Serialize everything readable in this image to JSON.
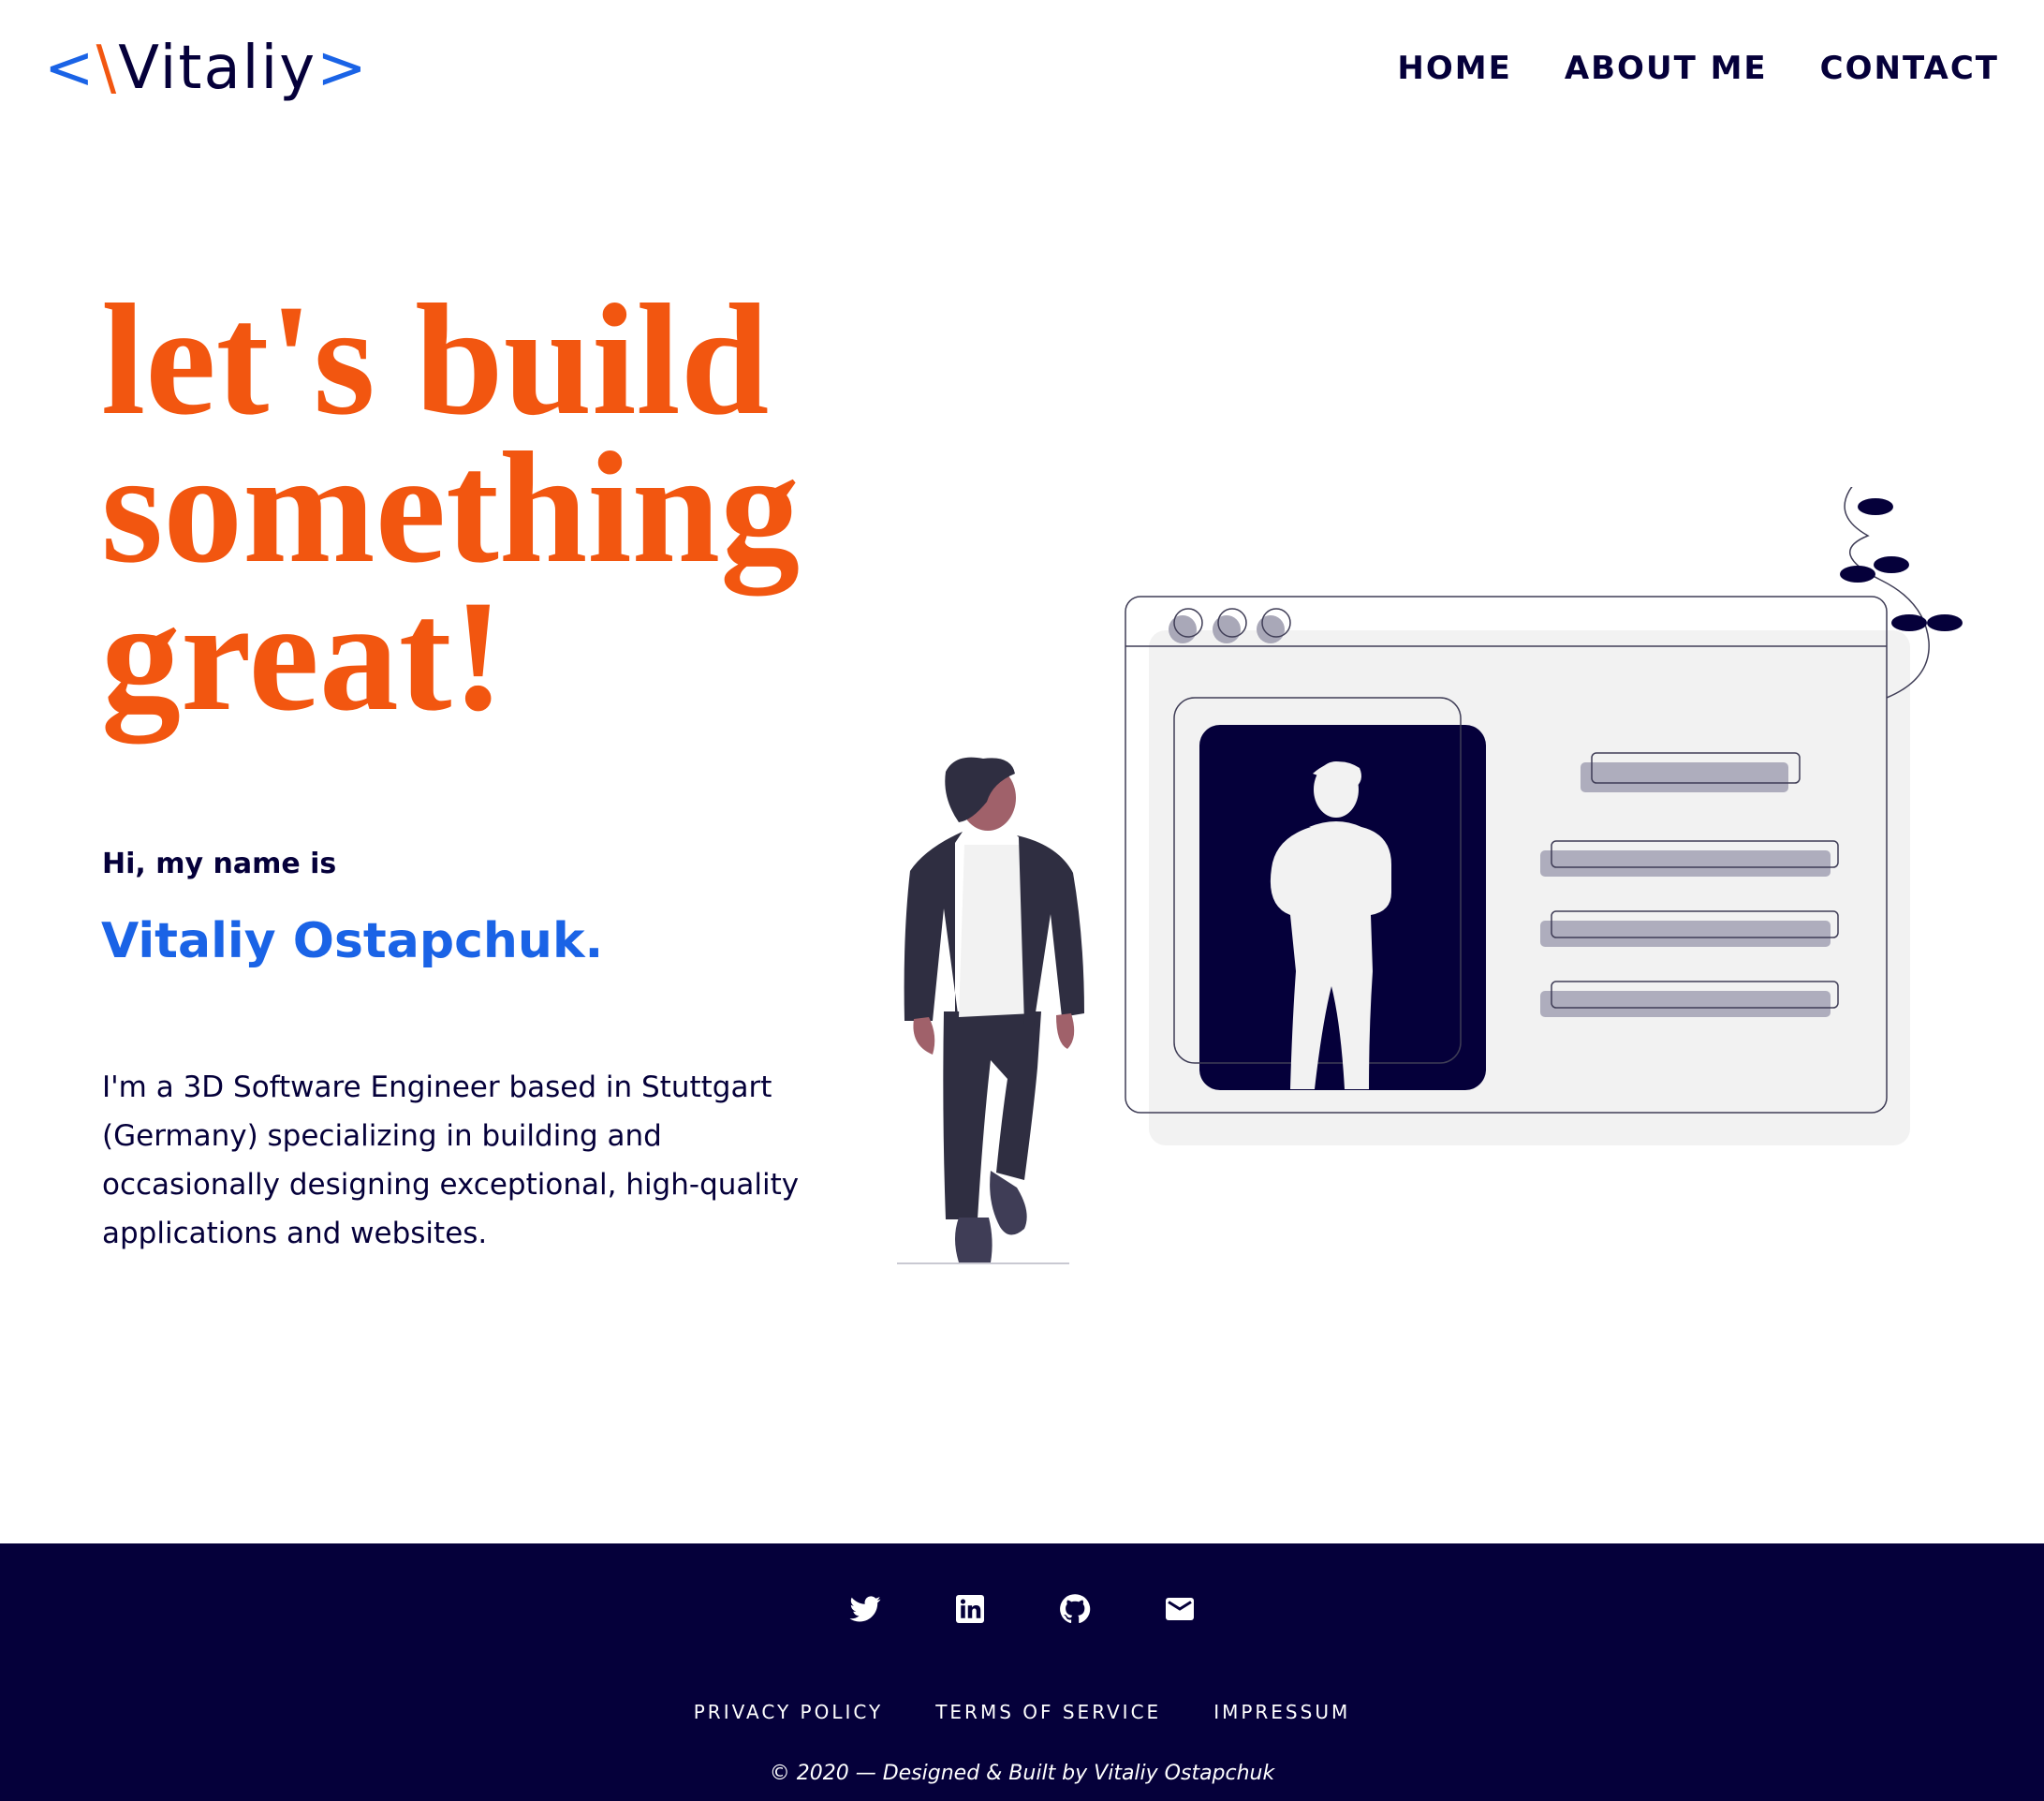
{
  "header": {
    "logo": {
      "open_bracket": "<",
      "slash": "\\",
      "name": "Vitaliy",
      "close_bracket": ">"
    },
    "nav": [
      "HOME",
      "ABOUT ME",
      "CONTACT"
    ]
  },
  "hero": {
    "headline": [
      "let's build",
      "something",
      "great!"
    ],
    "greeting": "Hi, my name is",
    "name": "Vitaliy Ostapchuk.",
    "bio": "I'm a 3D Software Engineer based in Stuttgart (Germany) specializing in building and occasionally designing exceptional, high-quality applications and websites."
  },
  "footer": {
    "socials": [
      "twitter-icon",
      "linkedin-icon",
      "github-icon",
      "mail-icon"
    ],
    "links": [
      "PRIVACY POLICY",
      "TERMS OF SERVICE",
      "IMPRESSUM"
    ],
    "copyright": "© 2020 — Designed & Built by Vitaliy Ostapchuk"
  },
  "colors": {
    "accent_orange": "#f25610",
    "accent_blue": "#1a63e6",
    "navy": "#05003a",
    "footer_bg": "#05003a",
    "card_gray": "#f2f2f2"
  }
}
